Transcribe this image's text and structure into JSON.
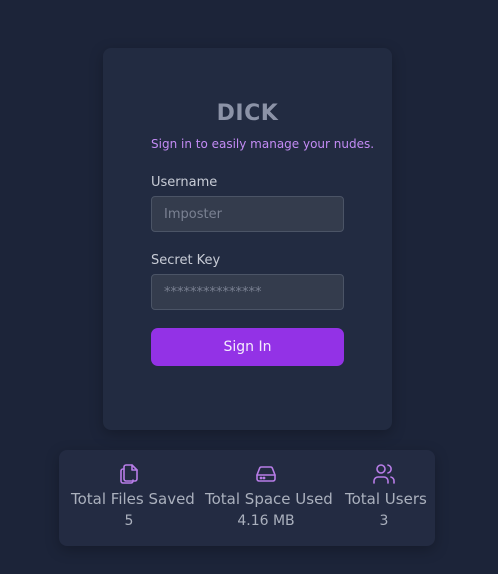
{
  "login": {
    "brand": "DICK",
    "tagline": "Sign in to easily manage your nudes.",
    "username_label": "Username",
    "username_placeholder": "Imposter",
    "secret_label": "Secret Key",
    "secret_placeholder": "***************",
    "signin_label": "Sign In"
  },
  "stats": [
    {
      "icon": "files-icon",
      "title": "Total Files Saved",
      "value": "5"
    },
    {
      "icon": "hard-drive-icon",
      "title": "Total Space Used",
      "value": "4.16 MB"
    },
    {
      "icon": "users-icon",
      "title": "Total Users",
      "value": "3"
    }
  ],
  "colors": {
    "background": "#1c2439",
    "card": "#222b41",
    "accent": "#9332e6",
    "tagline": "#c38bf4",
    "icon": "#b87de8"
  }
}
